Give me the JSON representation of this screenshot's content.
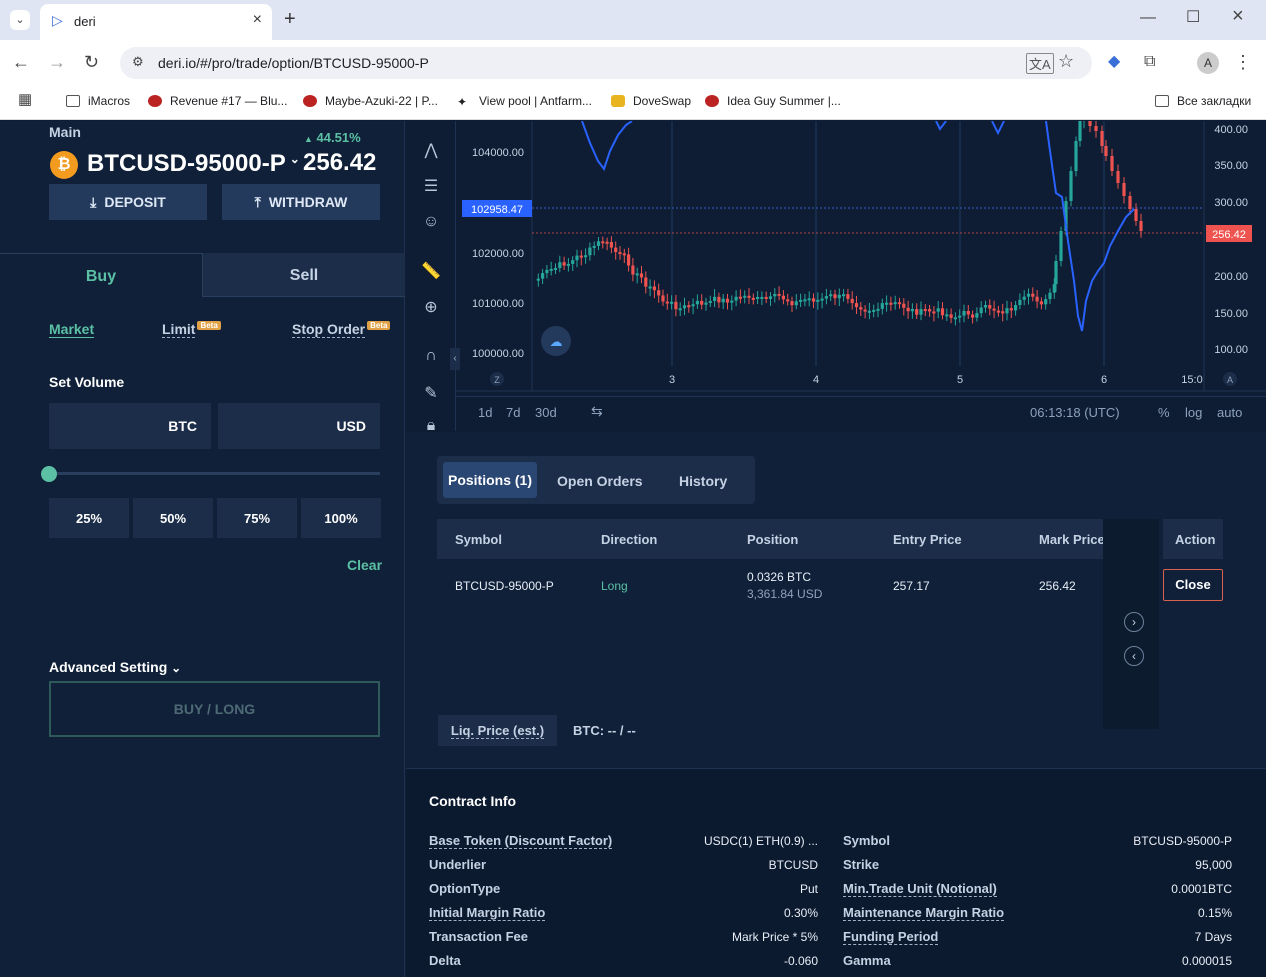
{
  "browser": {
    "tab_title": "deri",
    "url": "deri.io/#/pro/trade/option/BTCUSD-95000-P",
    "bookmarks": [
      {
        "label": "iMacros"
      },
      {
        "label": "Revenue #17 — Blu..."
      },
      {
        "label": "Maybe-Azuki-22 | P..."
      },
      {
        "label": "View pool | Antfarm..."
      },
      {
        "label": "DoveSwap"
      },
      {
        "label": "Idea Guy Summer |..."
      }
    ],
    "all_bookmarks": "Все закладки",
    "profile_initial": "A"
  },
  "header": {
    "account": "Main",
    "symbol": "BTCUSD-95000-P",
    "change": "44.51%",
    "price": "256.42",
    "deposit": "DEPOSIT",
    "withdraw": "WITHDRAW",
    "coin_glyph": "₿"
  },
  "order": {
    "buy_tab": "Buy",
    "sell_tab": "Sell",
    "market": "Market",
    "limit": "Limit",
    "stop": "Stop Order",
    "beta": "Beta",
    "set_volume": "Set Volume",
    "btc_unit": "BTC",
    "usd_unit": "USD",
    "slider_value": 0,
    "pct": [
      "25%",
      "50%",
      "75%",
      "100%"
    ],
    "clear": "Clear",
    "advanced": "Advanced Setting",
    "submit": "BUY / LONG"
  },
  "chart": {
    "crosshair_price": "102958.47",
    "last_price": "256.42",
    "left_axis": [
      "104000.00",
      "102000.00",
      "101000.00",
      "100000.00"
    ],
    "right_axis": [
      "400.00",
      "350.00",
      "300.00",
      "250.00",
      "200.00",
      "150.00",
      "100.00"
    ],
    "x_ticks": [
      "3",
      "4",
      "5",
      "6",
      "15:0"
    ],
    "ranges": [
      "1d",
      "7d",
      "30d"
    ],
    "time": "06:13:18 (UTC)",
    "opts": [
      "%",
      "log",
      "auto"
    ],
    "z_label": "Z",
    "a_label": "A",
    "colors": {
      "up": "#26a69a",
      "down": "#ef5350",
      "index_line": "#2962ff"
    }
  },
  "positions": {
    "tabs": [
      "Positions (1)",
      "Open Orders",
      "History"
    ],
    "headers": [
      "Symbol",
      "Direction",
      "Position",
      "Entry Price",
      "Mark Price",
      "Action"
    ],
    "row": {
      "symbol": "BTCUSD-95000-P",
      "direction": "Long",
      "position_btc": "0.0326 BTC",
      "position_usd": "3,361.84 USD",
      "entry": "257.17",
      "mark": "256.42",
      "action": "Close"
    },
    "liq_label": "Liq. Price (est.)",
    "liq_value": "BTC: -- / --"
  },
  "contract": {
    "title": "Contract Info",
    "left": [
      {
        "k": "Base Token (Discount Factor)",
        "v": "USDC(1) ETH(0.9) ..."
      },
      {
        "k": "Underlier",
        "v": "BTCUSD"
      },
      {
        "k": "OptionType",
        "v": "Put"
      },
      {
        "k": "Initial Margin Ratio",
        "v": "0.30%"
      },
      {
        "k": "Transaction Fee",
        "v": "Mark Price * 5%"
      },
      {
        "k": "Delta",
        "v": "-0.060"
      }
    ],
    "right": [
      {
        "k": "Symbol",
        "v": "BTCUSD-95000-P"
      },
      {
        "k": "Strike",
        "v": "95,000"
      },
      {
        "k": "Min.Trade Unit (Notional)",
        "v": "0.0001BTC"
      },
      {
        "k": "Maintenance Margin Ratio",
        "v": "0.15%"
      },
      {
        "k": "Funding Period",
        "v": "7 Days"
      },
      {
        "k": "Gamma",
        "v": "0.000015"
      }
    ]
  }
}
